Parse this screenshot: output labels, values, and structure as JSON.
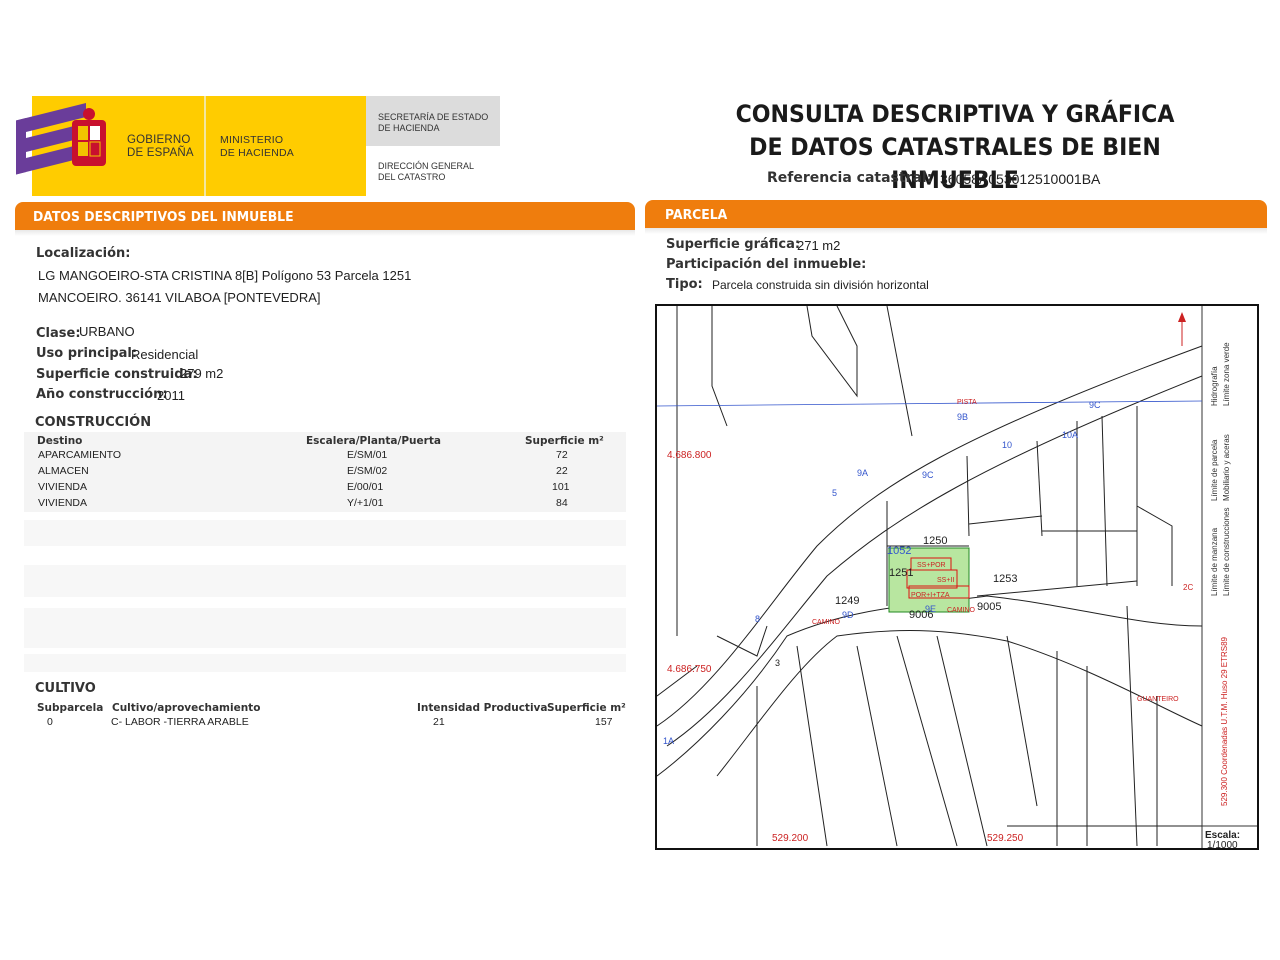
{
  "header": {
    "gobierno_line1": "GOBIERNO",
    "gobierno_line2": "DE ESPAÑA",
    "ministerio_line1": "MINISTERIO",
    "ministerio_line2": "DE HACIENDA",
    "secretaria_line1": "SECRETARÍA DE ESTADO",
    "secretaria_line2": "DE HACIENDA",
    "direccion_line1": "DIRECCIÓN GENERAL",
    "direccion_line2": "DEL CATASTRO",
    "title_line1": "CONSULTA DESCRIPTIVA Y GRÁFICA",
    "title_line2": "DE DATOS CATASTRALES DE BIEN INMUEBLE",
    "ref_label": "Referencia catastral:",
    "ref_value": "36058A053012510001BA",
    "colors": {
      "banner": "#ffcc00",
      "accent": "#ef7d0d",
      "logo": "#6a3d9a"
    }
  },
  "descriptivos": {
    "section_title": "DATOS DESCRIPTIVOS DEL INMUEBLE",
    "localizacion_label": "Localización:",
    "localizacion_line1": "LG MANGOEIRO-STA CRISTINA 8[B] Polígono 53 Parcela 1251",
    "localizacion_line2": "MANCOEIRO. 36141 VILABOA [PONTEVEDRA]",
    "clase_label": "Clase:",
    "clase_value": "URBANO",
    "uso_label": "Uso principal:",
    "uso_value": "Residencial",
    "superficie_label": "Superficie construida:",
    "superficie_value": "279 m2",
    "anio_label": "Año construcción:",
    "anio_value": "2011"
  },
  "construccion": {
    "title": "CONSTRUCCIÓN",
    "headers": [
      "Destino",
      "Escalera/Planta/Puerta",
      "Superficie m²"
    ],
    "rows": [
      [
        "APARCAMIENTO",
        "E/SM/01",
        "72"
      ],
      [
        "ALMACEN",
        "E/SM/02",
        "22"
      ],
      [
        "VIVIENDA",
        "E/00/01",
        "101"
      ],
      [
        "VIVIENDA",
        "Y/+1/01",
        "84"
      ]
    ]
  },
  "cultivo": {
    "title": "CULTIVO",
    "headers": [
      "Subparcela",
      "Cultivo/aprovechamiento",
      "Intensidad Productiva",
      "Superficie m²"
    ],
    "rows": [
      [
        "0",
        "C- LABOR -TIERRA ARABLE",
        "21",
        "157"
      ]
    ]
  },
  "parcela": {
    "section_title": "PARCELA",
    "superficie_label": "Superficie gráfica:",
    "superficie_value": "271 m2",
    "participacion_label": "Participación del inmueble:",
    "tipo_label": "Tipo:",
    "tipo_value": "Parcela construida sin división horizontal"
  },
  "map": {
    "coord_y_top": "4.686.800",
    "coord_y_bottom": "4.686.750",
    "coord_x_left": "529.200",
    "coord_x_right": "529.250",
    "parcels": [
      "1250",
      "1251",
      "1253",
      "1249",
      "9005",
      "9006",
      "1052"
    ],
    "road_labels": [
      "9C",
      "10",
      "10A",
      "9B",
      "9A",
      "9C",
      "9D",
      "9E",
      "8",
      "5",
      "3",
      "1A",
      "2C"
    ],
    "place_labels": [
      "PISTA",
      "CAMINO",
      "CAMINO",
      "GUANTEIRO",
      "SS+POR",
      "SS+II",
      "POR+I+TZA"
    ],
    "legend": [
      "Límite de manzana",
      "Límite de parcela",
      "Límite de construcciones",
      "Mobiliario y aceras",
      "Límite zona verde",
      "Hidrografía"
    ],
    "coord_note": "529.300 Coordenadas U.T.M. Huso 29 ETRS89",
    "escala_label": "Escala:",
    "escala_value": "1/1000"
  }
}
